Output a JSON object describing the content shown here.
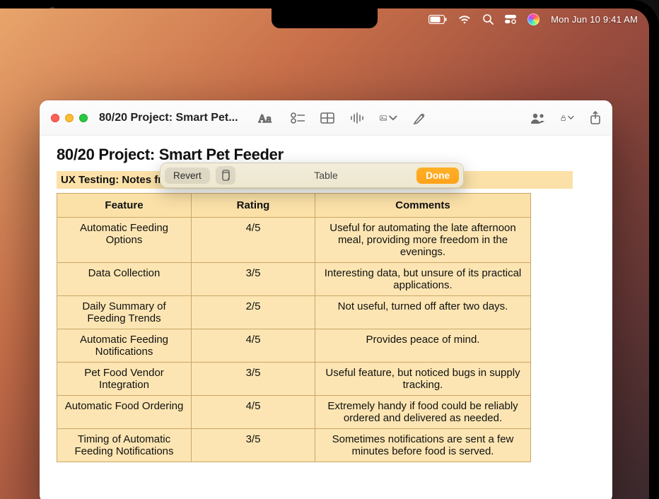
{
  "menubar": {
    "clock": "Mon Jun 10  9:41 AM"
  },
  "window": {
    "title": "80/20 Project: Smart Pet..."
  },
  "document": {
    "title": "80/20 Project: Smart Pet Feeder",
    "subtitle": "UX Testing: Notes fro"
  },
  "popover": {
    "revert": "Revert",
    "label": "Table",
    "done": "Done"
  },
  "table": {
    "headers": [
      "Feature",
      "Rating",
      "Comments"
    ],
    "rows": [
      {
        "feature": "Automatic Feeding Options",
        "rating": "4/5",
        "comments": "Useful for automating the late afternoon meal, providing more freedom in the evenings."
      },
      {
        "feature": "Data Collection",
        "rating": "3/5",
        "comments": "Interesting data, but unsure of its practical applications."
      },
      {
        "feature": "Daily Summary of Feeding Trends",
        "rating": "2/5",
        "comments": "Not useful, turned off after two days."
      },
      {
        "feature": "Automatic Feeding Notifications",
        "rating": "4/5",
        "comments": "Provides peace of mind."
      },
      {
        "feature": "Pet Food Vendor Integration",
        "rating": "3/5",
        "comments": "Useful feature, but noticed bugs in supply tracking."
      },
      {
        "feature": "Automatic Food Ordering",
        "rating": "4/5",
        "comments": "Extremely handy if food could be reliably ordered and delivered as needed."
      },
      {
        "feature": "Timing of Automatic Feeding Notifications",
        "rating": "3/5",
        "comments": "Sometimes notifications are sent a few minutes before food is served."
      }
    ]
  }
}
